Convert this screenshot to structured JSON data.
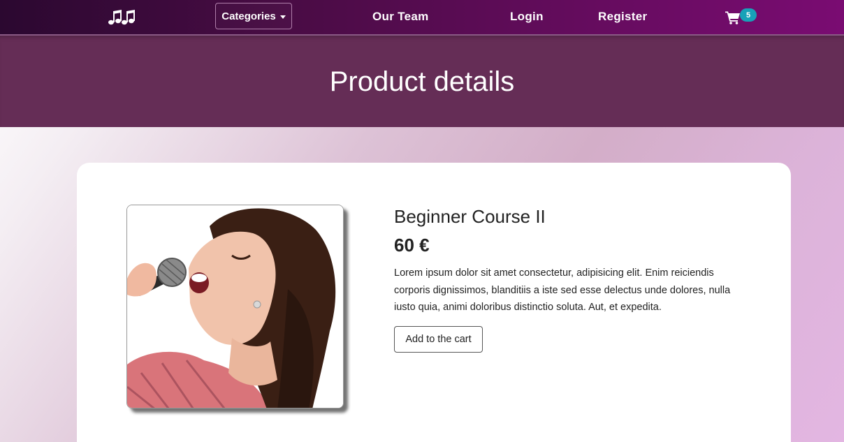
{
  "navbar": {
    "logo_icon": "music-notes-icon",
    "categories_label": "Categories",
    "links": [
      "Our Team",
      "Login",
      "Register"
    ],
    "cart_icon": "shopping-cart-icon",
    "cart_count": "5",
    "colors": {
      "accent": "#650c5e",
      "badge": "#17a2b8"
    }
  },
  "hero": {
    "title": "Product details",
    "background": "#652d56"
  },
  "product": {
    "title": "Beginner Course II",
    "price": "60 €",
    "description": "Lorem ipsum dolor sit amet consectetur, adipisicing elit. Enim reiciendis corporis dignissimos, blanditiis a iste sed esse delectus unde dolores, nulla iusto quia, animi doloribus distinctio soluta. Aut, et expedita.",
    "add_to_cart_label": "Add to the cart",
    "image_subject": "woman singing into microphone"
  }
}
